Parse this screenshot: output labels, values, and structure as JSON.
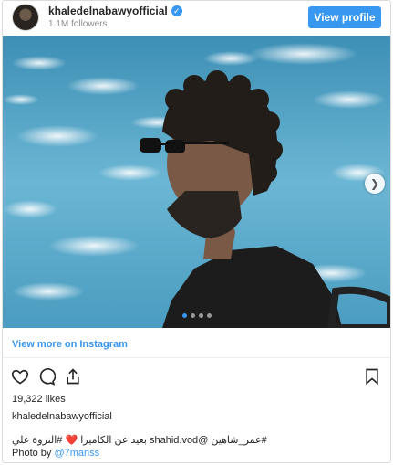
{
  "header": {
    "username": "khaledelnabawyofficial",
    "followers": "1.1M followers",
    "view_profile_label": "View profile",
    "verified_icon": "verified-badge-icon"
  },
  "carousel": {
    "total_slides": 4,
    "active_slide": 1,
    "next_icon": "chevron-right-icon"
  },
  "view_more_label": "View more on Instagram",
  "actions": {
    "icons": [
      "heart-icon",
      "comment-icon",
      "share-icon"
    ],
    "save_icon": "bookmark-icon"
  },
  "likes": "19,322 likes",
  "caption": {
    "username": "khaledelnabawyofficial",
    "text": "#عمر_شاهين @shahid.vod بعيد عن الكاميرا ❤️ #النزوة علي",
    "photo_by_prefix": "Photo by",
    "photo_by_handle": "@7manss"
  },
  "colors": {
    "accent": "#3897f0",
    "water": "#5ba9c8",
    "text": "#262626",
    "muted": "#8e8e8e"
  }
}
